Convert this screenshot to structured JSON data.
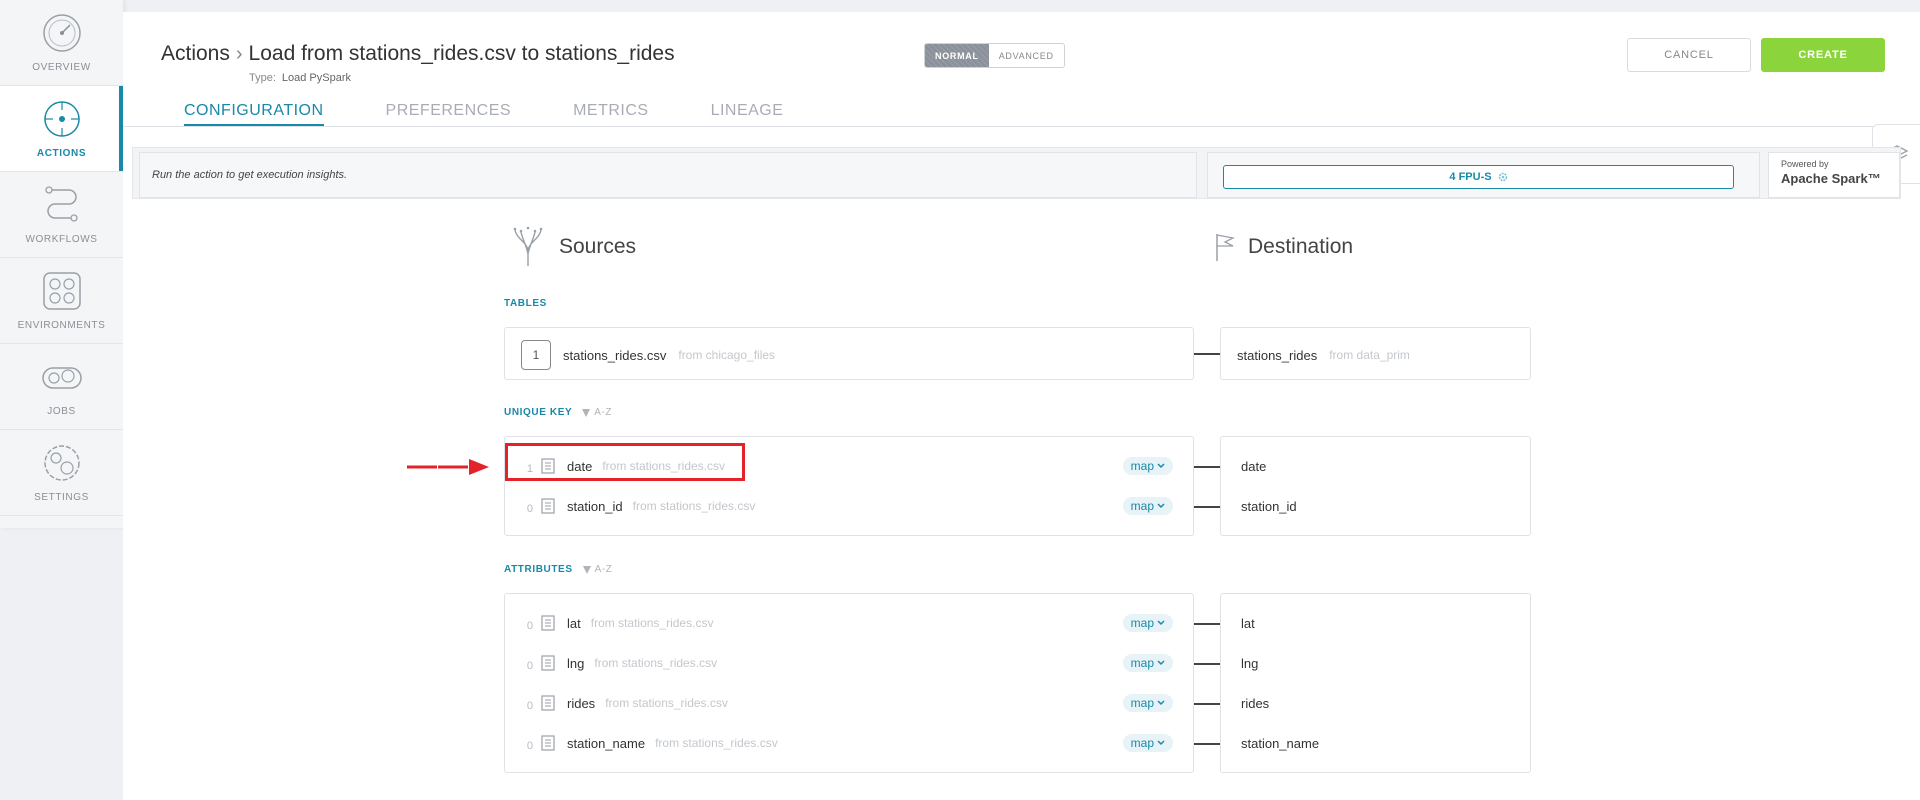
{
  "sidebar": {
    "items": [
      {
        "label": "OVERVIEW",
        "icon": "overview-gauge-icon",
        "active": false
      },
      {
        "label": "ACTIONS",
        "icon": "actions-target-icon",
        "active": true
      },
      {
        "label": "WORKFLOWS",
        "icon": "workflows-path-icon",
        "active": false
      },
      {
        "label": "ENVIRONMENTS",
        "icon": "environments-grid-icon",
        "active": false
      },
      {
        "label": "JOBS",
        "icon": "jobs-gears-icon",
        "active": false
      },
      {
        "label": "SETTINGS",
        "icon": "settings-gear-icon",
        "active": false
      }
    ]
  },
  "header": {
    "root": "Actions",
    "title": "Load from stations_rides.csv to stations_rides",
    "type_label": "Type:",
    "type_value": "Load PySpark",
    "mode_normal": "NORMAL",
    "mode_advanced": "ADVANCED",
    "cancel": "CANCEL",
    "create": "CREATE"
  },
  "tabs": [
    "CONFIGURATION",
    "PREFERENCES",
    "METRICS",
    "LINEAGE"
  ],
  "insights": {
    "message": "Run the action to get execution insights.",
    "fpu": "4 FPU-S",
    "powered_by": "Powered by",
    "engine": "Apache Spark™"
  },
  "sources": {
    "title": "Sources",
    "tables_label": "TABLES",
    "table": {
      "index": "1",
      "name": "stations_rides.csv",
      "from": "from chicago_files"
    },
    "unique_key_label": "UNIQUE KEY",
    "sort_label": "A-Z",
    "unique_keys": [
      {
        "num": "1",
        "name": "date",
        "from": "from stations_rides.csv",
        "map": "map"
      },
      {
        "num": "0",
        "name": "station_id",
        "from": "from stations_rides.csv",
        "map": "map"
      }
    ],
    "attributes_label": "ATTRIBUTES",
    "attributes": [
      {
        "num": "0",
        "name": "lat",
        "from": "from stations_rides.csv",
        "map": "map"
      },
      {
        "num": "0",
        "name": "lng",
        "from": "from stations_rides.csv",
        "map": "map"
      },
      {
        "num": "0",
        "name": "rides",
        "from": "from stations_rides.csv",
        "map": "map"
      },
      {
        "num": "0",
        "name": "station_name",
        "from": "from stations_rides.csv",
        "map": "map"
      }
    ]
  },
  "destination": {
    "title": "Destination",
    "table": {
      "name": "stations_rides",
      "from": "from data_prim"
    },
    "unique_keys": [
      "date",
      "station_id"
    ],
    "attributes": [
      "lat",
      "lng",
      "rides",
      "station_name"
    ]
  },
  "colors": {
    "accent": "#1889a8",
    "create": "#8cd43c",
    "highlight": "#e4222a"
  }
}
